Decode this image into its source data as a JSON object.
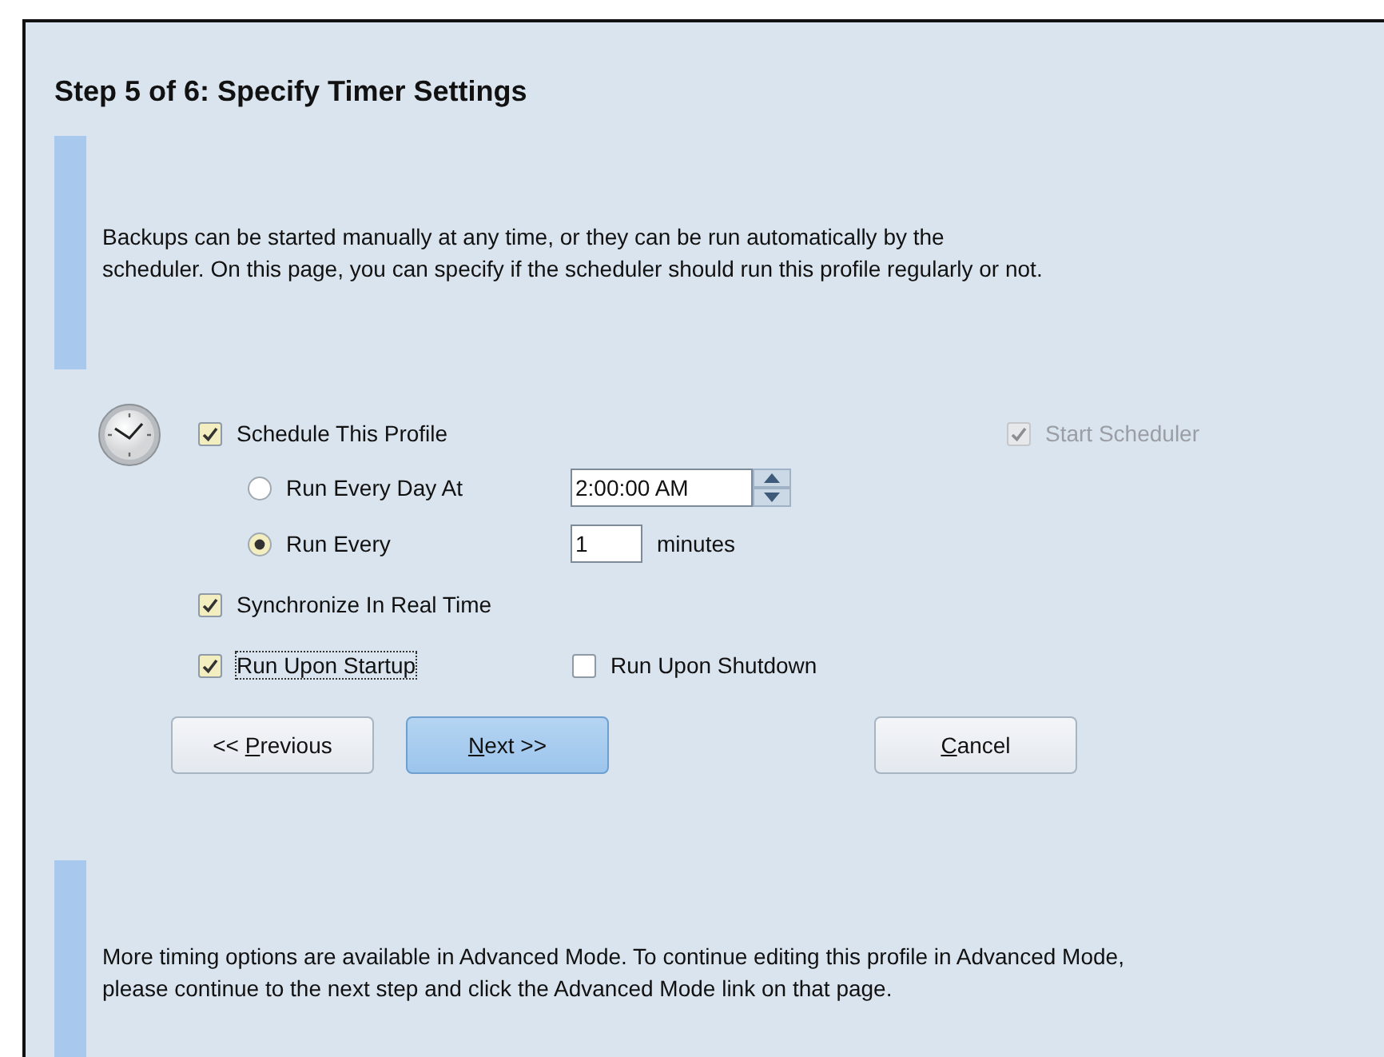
{
  "title": "Step 5 of 6: Specify Timer Settings",
  "intro": "Backups can be started manually at any time, or they can be run automatically by the\nscheduler. On this page, you can specify if the scheduler should run this profile regularly or not.",
  "schedule": {
    "label": "Schedule This Profile",
    "checked": true,
    "disabled": false
  },
  "start_scheduler": {
    "label": "Start Scheduler",
    "checked": true,
    "disabled": true
  },
  "modes": [
    {
      "kind": "time",
      "label": "Run Every Day At",
      "selected": false,
      "value": "2:00:00 AM"
    },
    {
      "kind": "interval",
      "label": "Run Every",
      "selected": true,
      "value": "1",
      "unit": "minutes"
    }
  ],
  "option_rows": [
    {
      "items": [
        {
          "label": "Synchronize In Real Time",
          "checked": true,
          "focused": false
        }
      ]
    },
    {
      "items": [
        {
          "label": "Run Upon Startup",
          "checked": true,
          "focused": true
        },
        {
          "label": "Run Upon Shutdown",
          "checked": false,
          "focused": false
        }
      ]
    }
  ],
  "buttons": [
    {
      "prefix": "<< ",
      "accel": "P",
      "rest": "revious",
      "default": false
    },
    {
      "accel": "N",
      "rest": "ext >>",
      "default": true
    },
    {
      "accel": "C",
      "rest": "ancel",
      "default": false
    }
  ],
  "footer": "More timing options are available in Advanced Mode. To continue editing this profile in Advanced Mode,\nplease continue to the next step and click the Advanced Mode link on that page."
}
